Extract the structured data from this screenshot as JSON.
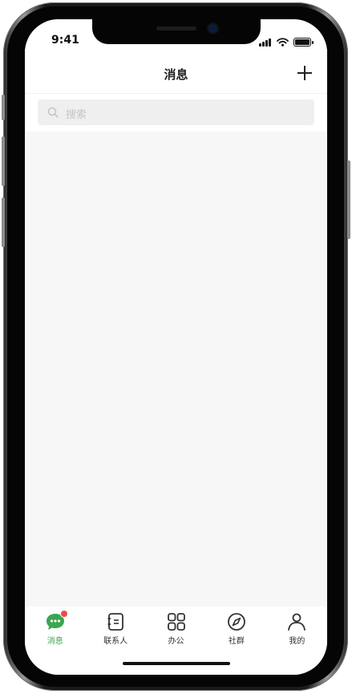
{
  "status_bar": {
    "time": "9:41"
  },
  "nav": {
    "title": "消息",
    "add_icon": "plus-icon"
  },
  "search": {
    "placeholder": "搜索",
    "icon": "search-icon"
  },
  "tabs": [
    {
      "label": "消息",
      "icon": "chat-bubble-icon",
      "active": true,
      "badge": true
    },
    {
      "label": "联系人",
      "icon": "contacts-book-icon",
      "active": false
    },
    {
      "label": "办公",
      "icon": "grid-apps-icon",
      "active": false
    },
    {
      "label": "社群",
      "icon": "compass-icon",
      "active": false
    },
    {
      "label": "我的",
      "icon": "person-icon",
      "active": false
    }
  ],
  "colors": {
    "accent": "#3aa650",
    "badge": "#ef4b4b",
    "background": "#f7f7f7"
  }
}
